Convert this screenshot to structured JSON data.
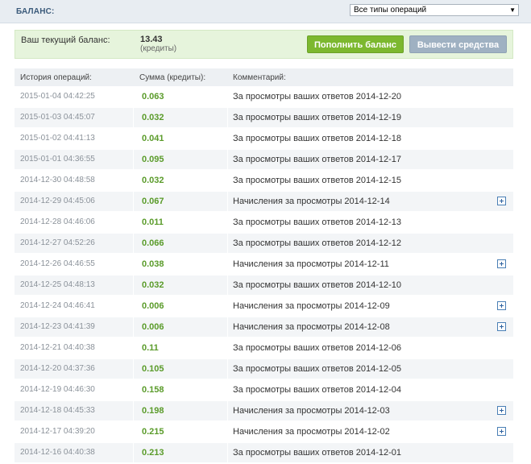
{
  "header": {
    "title": "БАЛАНС:",
    "filter_value": "Все типы операций",
    "filter_arrow": "▼"
  },
  "balance": {
    "label": "Ваш текущий баланс:",
    "value": "13.43",
    "unit": "(кредиты)",
    "topup_label": "Пополнить баланс",
    "withdraw_label": "Вывести средства"
  },
  "table": {
    "headers": [
      "История операций:",
      "Сумма (кредиты):",
      "Комментарий:"
    ],
    "rows": [
      {
        "date": "2015-01-04 04:42:25",
        "amount": "0.063",
        "comment": "За просмотры ваших ответов 2014-12-20",
        "expandable": false
      },
      {
        "date": "2015-01-03 04:45:07",
        "amount": "0.032",
        "comment": "За просмотры ваших ответов 2014-12-19",
        "expandable": false
      },
      {
        "date": "2015-01-02 04:41:13",
        "amount": "0.041",
        "comment": "За просмотры ваших ответов 2014-12-18",
        "expandable": false
      },
      {
        "date": "2015-01-01 04:36:55",
        "amount": "0.095",
        "comment": "За просмотры ваших ответов 2014-12-17",
        "expandable": false
      },
      {
        "date": "2014-12-30 04:48:58",
        "amount": "0.032",
        "comment": "За просмотры ваших ответов 2014-12-15",
        "expandable": false
      },
      {
        "date": "2014-12-29 04:45:06",
        "amount": "0.067",
        "comment": "Начисления за просмотры 2014-12-14",
        "expandable": true
      },
      {
        "date": "2014-12-28 04:46:06",
        "amount": "0.011",
        "comment": "За просмотры ваших ответов 2014-12-13",
        "expandable": false
      },
      {
        "date": "2014-12-27 04:52:26",
        "amount": "0.066",
        "comment": "За просмотры ваших ответов 2014-12-12",
        "expandable": false
      },
      {
        "date": "2014-12-26 04:46:55",
        "amount": "0.038",
        "comment": "Начисления за просмотры 2014-12-11",
        "expandable": true
      },
      {
        "date": "2014-12-25 04:48:13",
        "amount": "0.032",
        "comment": "За просмотры ваших ответов 2014-12-10",
        "expandable": false
      },
      {
        "date": "2014-12-24 04:46:41",
        "amount": "0.006",
        "comment": "Начисления за просмотры 2014-12-09",
        "expandable": true
      },
      {
        "date": "2014-12-23 04:41:39",
        "amount": "0.006",
        "comment": "Начисления за просмотры 2014-12-08",
        "expandable": true
      },
      {
        "date": "2014-12-21 04:40:38",
        "amount": "0.11",
        "comment": "За просмотры ваших ответов 2014-12-06",
        "expandable": false
      },
      {
        "date": "2014-12-20 04:37:36",
        "amount": "0.105",
        "comment": "За просмотры ваших ответов 2014-12-05",
        "expandable": false
      },
      {
        "date": "2014-12-19 04:46:30",
        "amount": "0.158",
        "comment": "За просмотры ваших ответов 2014-12-04",
        "expandable": false
      },
      {
        "date": "2014-12-18 04:45:33",
        "amount": "0.198",
        "comment": "Начисления за просмотры 2014-12-03",
        "expandable": true
      },
      {
        "date": "2014-12-17 04:39:20",
        "amount": "0.215",
        "comment": "Начисления за просмотры 2014-12-02",
        "expandable": true
      },
      {
        "date": "2014-12-16 04:40:38",
        "amount": "0.213",
        "comment": "За просмотры ваших ответов 2014-12-01",
        "expandable": false
      }
    ]
  },
  "colors": {
    "accent_green": "#7cb82f",
    "amount_green": "#5a9b2a",
    "muted_button": "#9fb1c2",
    "balance_bg": "#e6f4dc",
    "header_bg": "#e8edf2"
  }
}
